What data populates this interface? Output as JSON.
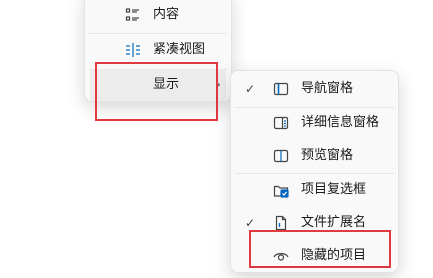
{
  "left_menu": {
    "items": [
      {
        "label": "内容",
        "icon": "list-details-icon"
      },
      {
        "label": "紧凑视图",
        "icon": "compact-view-icon"
      },
      {
        "label": "显示",
        "icon": "",
        "submenu_arrow": "›"
      }
    ]
  },
  "show_submenu": {
    "items": [
      {
        "label": "导航窗格",
        "icon": "navigation-pane-icon",
        "checked": true,
        "check": "✓"
      },
      {
        "label": "详细信息窗格",
        "icon": "details-pane-icon",
        "checked": false
      },
      {
        "label": "预览窗格",
        "icon": "preview-pane-icon",
        "checked": false
      },
      {
        "label": "项目复选框",
        "icon": "item-checkbox-icon",
        "checked": false
      },
      {
        "label": "文件扩展名",
        "icon": "file-extension-icon",
        "checked": true,
        "check": "✓"
      },
      {
        "label": "隐藏的项目",
        "icon": "eye-icon",
        "checked": false
      }
    ]
  },
  "colors": {
    "highlight_border": "#e0393e",
    "accent": "#0067c0"
  }
}
